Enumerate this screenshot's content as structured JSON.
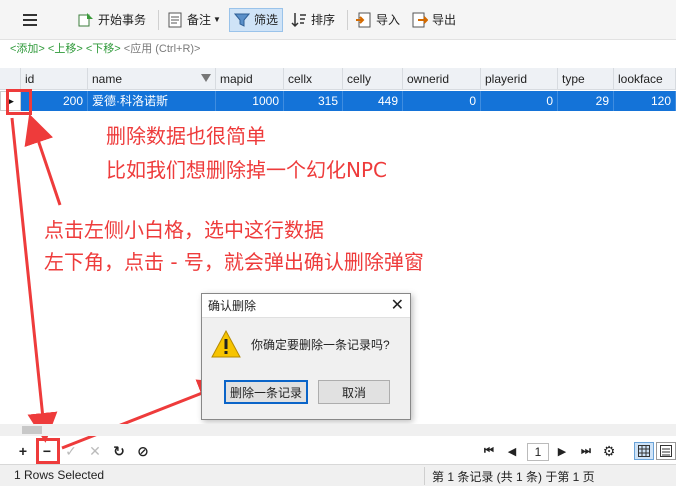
{
  "toolbar": {
    "begin_transaction": "开始事务",
    "memo": "备注",
    "filter": "筛选",
    "sort": "排序",
    "import": "导入",
    "export": "导出"
  },
  "hint": {
    "add": "<添加>",
    "up": "<上移>",
    "down": "<下移>",
    "apply": "<应用 (Ctrl+R)>"
  },
  "table": {
    "columns": [
      "id",
      "name",
      "mapid",
      "cellx",
      "celly",
      "ownerid",
      "playerid",
      "type",
      "lookface"
    ],
    "row": [
      "200",
      "爱德·科洛诺斯",
      "1000",
      "315",
      "449",
      "0",
      "0",
      "29",
      "120"
    ]
  },
  "annotations": {
    "line1": "删除数据也很简单",
    "line2": "比如我们想删除掉一个幻化NPC",
    "line3": "点击左侧小白格，选中这行数据",
    "line4": "左下角，点击 - 号，就会弹出确认删除弹窗"
  },
  "dialog": {
    "title": "确认删除",
    "message": "你确定要删除一条记录吗?",
    "confirm": "删除一条记录",
    "cancel": "取消"
  },
  "pager": {
    "page": "1"
  },
  "status": {
    "selected": "1 Rows Selected",
    "record_info": "第 1 条记录 (共 1 条) 于第 1 页"
  },
  "colors": {
    "accent": "#1473d8",
    "annotation": "#ee3b3b"
  }
}
